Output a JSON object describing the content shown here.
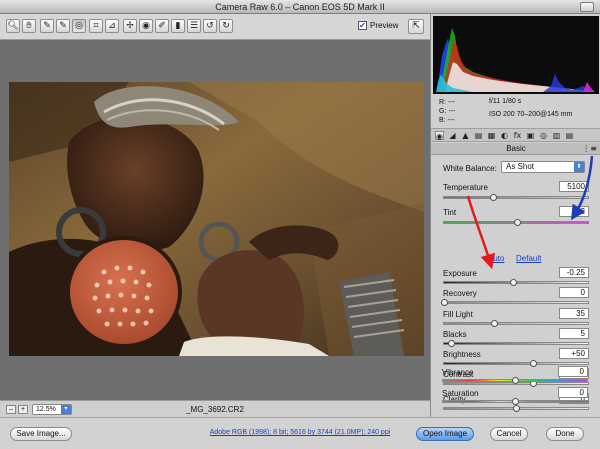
{
  "window": {
    "title": "Camera Raw 6.0  –  Canon EOS 5D Mark II"
  },
  "toolbar": {
    "tools": [
      {
        "name": "zoom-tool",
        "glyph": "🔍︎"
      },
      {
        "name": "hand-tool",
        "glyph": "✋︎"
      },
      {
        "name": "white-balance-tool",
        "glyph": "✎"
      },
      {
        "name": "color-sampler-tool",
        "glyph": "✎"
      },
      {
        "name": "targeted-adjustment-tool",
        "glyph": "◎"
      },
      {
        "name": "crop-tool",
        "glyph": "⌗"
      },
      {
        "name": "straighten-tool",
        "glyph": "⊿"
      },
      {
        "name": "spot-removal-tool",
        "glyph": "✢"
      },
      {
        "name": "red-eye-tool",
        "glyph": "◉"
      },
      {
        "name": "adjustment-brush-tool",
        "glyph": "✐"
      },
      {
        "name": "graduated-filter-tool",
        "glyph": "▮"
      },
      {
        "name": "preferences-tool",
        "glyph": "☰"
      },
      {
        "name": "rotate-left-tool",
        "glyph": "↺"
      },
      {
        "name": "rotate-right-tool",
        "glyph": "↻"
      }
    ],
    "preview_check": "✔",
    "preview_label": "Preview",
    "fullscreen_glyph": "⇱"
  },
  "status": {
    "zoom_out": "–",
    "zoom_in": "+",
    "zoom_level": "12.5%",
    "zoom_arrow": "▾",
    "filename": "_MG_3692.CR2"
  },
  "buttons": {
    "save": "Save Image...",
    "workflow": "Adobe RGB (1998); 8 bit; 5616 by 3744 (21.0MP); 240 ppi",
    "open": "Open Image",
    "cancel": "Cancel",
    "done": "Done"
  },
  "readout": {
    "r": "R:   ---",
    "g": "G:   ---",
    "b": "B:   ---",
    "aperture_shutter": "f/11    1/80 s",
    "iso_lens": "ISO 200    70–200@145 mm"
  },
  "panel": {
    "section_title": "Basic",
    "menu_glyph": "⋮≡",
    "tabs": [
      "◉",
      "◢",
      "▲",
      "▤",
      "▦",
      "◐",
      "fx",
      "▣",
      "◎",
      "▥",
      "▤"
    ],
    "white_balance_label": "White Balance:",
    "white_balance_value": "As Shot",
    "wb_arrow": "⬍",
    "auto_label": "Auto",
    "default_label": "Default",
    "sliders": [
      {
        "key": "temperature",
        "label": "Temperature",
        "value": "5100",
        "pos": 0.34
      },
      {
        "key": "tint",
        "label": "Tint",
        "value": "+2",
        "pos": 0.51
      },
      {
        "key": "exposure",
        "label": "Exposure",
        "value": "-0.25",
        "pos": 0.48
      },
      {
        "key": "recovery",
        "label": "Recovery",
        "value": "0",
        "pos": 0.0
      },
      {
        "key": "fill-light",
        "label": "Fill Light",
        "value": "35",
        "pos": 0.35
      },
      {
        "key": "blacks",
        "label": "Blacks",
        "value": "5",
        "pos": 0.05
      },
      {
        "key": "brightness",
        "label": "Brightness",
        "value": "+50",
        "pos": 0.62
      },
      {
        "key": "contrast",
        "label": "Contrast",
        "value": "+25",
        "pos": 0.62
      },
      {
        "key": "clarity",
        "label": "Clarity",
        "value": "0",
        "pos": 0.5
      },
      {
        "key": "vibrance",
        "label": "Vibrance",
        "value": "0",
        "pos": 0.5
      },
      {
        "key": "saturation",
        "label": "Saturation",
        "value": "0",
        "pos": 0.5
      }
    ]
  },
  "colors": {
    "annotation_red": "#e21b1b",
    "annotation_blue": "#1e3bb8",
    "link_blue": "#1b3fbf",
    "select_blue": "#4a7fd1"
  }
}
